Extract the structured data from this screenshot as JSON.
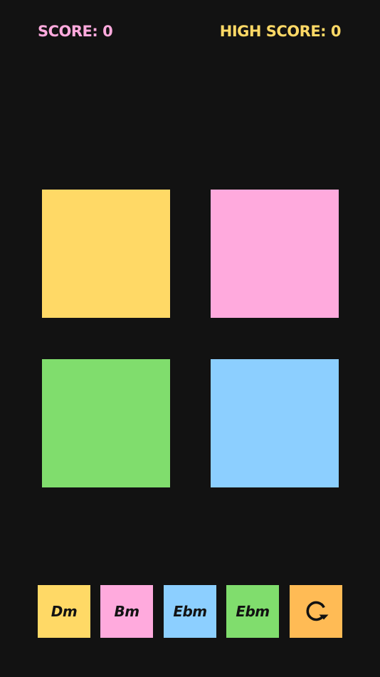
{
  "colors": {
    "background": "#121212",
    "yellow": "#ffd966",
    "pink": "#ffaadd",
    "green": "#80dd6d",
    "blue": "#8ccfff",
    "orange": "#ffbb55",
    "text_dark": "#121212"
  },
  "header": {
    "score_text": "SCORE: 0",
    "score_value": 0,
    "high_score_text": "HIGH SCORE: 0",
    "high_score_value": 0
  },
  "pads": [
    {
      "name": "yellow-pad",
      "color": "yellow"
    },
    {
      "name": "pink-pad",
      "color": "pink"
    },
    {
      "name": "green-pad",
      "color": "green"
    },
    {
      "name": "blue-pad",
      "color": "blue"
    }
  ],
  "chords": [
    {
      "label": "Dm",
      "color": "yellow"
    },
    {
      "label": "Bm",
      "color": "pink"
    },
    {
      "label": "Ebm",
      "color": "blue"
    },
    {
      "label": "Ebm",
      "color": "green"
    }
  ],
  "restart_button": {
    "icon": "restart-icon",
    "color": "orange"
  }
}
